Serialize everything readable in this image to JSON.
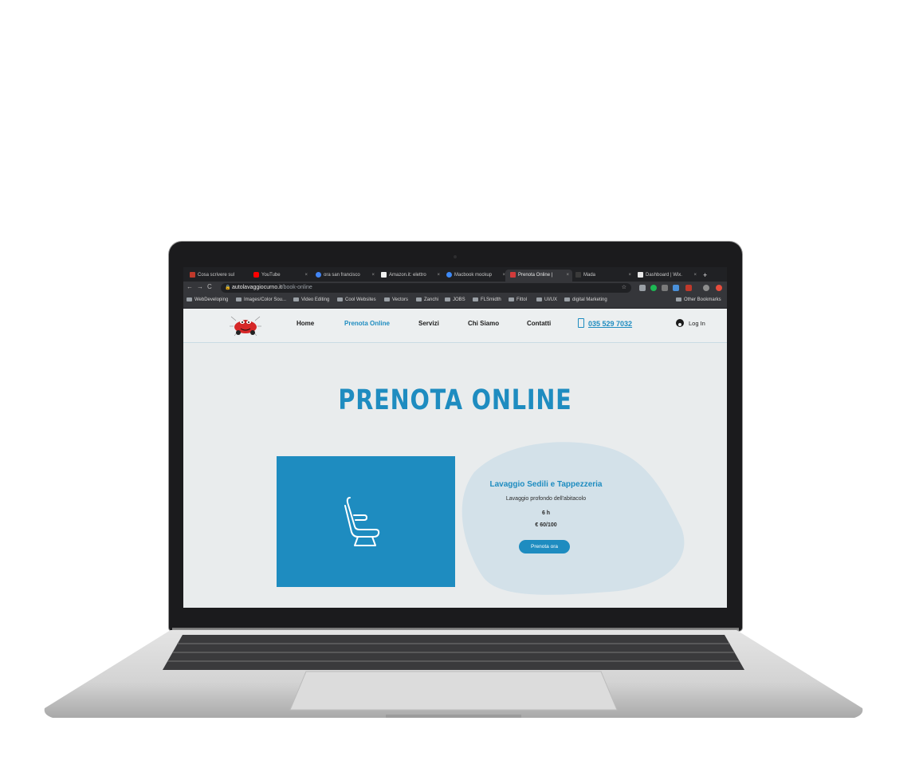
{
  "browser": {
    "tabs": [
      {
        "label": "Cosa scrivere sul",
        "icon": "image-favicon-icon",
        "active": false
      },
      {
        "label": "YouTube",
        "icon": "youtube-icon",
        "active": false
      },
      {
        "label": "ora san francisco",
        "icon": "google-icon",
        "active": false
      },
      {
        "label": "Amazon.it: elettro",
        "icon": "amazon-icon",
        "active": false
      },
      {
        "label": "Macbook mockup",
        "icon": "dropbox-icon",
        "active": false
      },
      {
        "label": "Prenota Online |",
        "icon": "wix-icon",
        "active": true
      },
      {
        "label": "Mada",
        "icon": "generic-favicon-icon",
        "active": false
      },
      {
        "label": "Dashboard | Wix.",
        "icon": "wix-icon",
        "active": false
      }
    ],
    "new_tab_label": "+",
    "url_domain": "autolavaggiocurno.it",
    "url_path": "/book-online",
    "bookmarks": [
      "WebDeveloping",
      "Images/Color Sou...",
      "Video Editing",
      "Cool Websites",
      "Vectors",
      "Zanchi",
      "JOBS",
      "FLSmidth",
      "Fittol",
      "UI/UX",
      "digital Marketing"
    ],
    "other_bookmarks": "Other Bookmarks"
  },
  "site": {
    "nav": {
      "home": "Home",
      "prenota": "Prenota Online",
      "servizi": "Servizi",
      "chi_siamo": "Chi Siamo",
      "contatti": "Contatti"
    },
    "phone": "035 529 7032",
    "login": "Log In",
    "page_title": "PRENOTA ONLINE",
    "service": {
      "title": "Lavaggio Sedili e Tappezzeria",
      "description": "Lavaggio profondo dell'abitacolo",
      "duration": "6 h",
      "price": "€ 60/100",
      "button": "Prenota ora"
    }
  },
  "colors": {
    "accent": "#1e8cc0",
    "blob": "#d3e1e9",
    "background": "#e9eced"
  }
}
